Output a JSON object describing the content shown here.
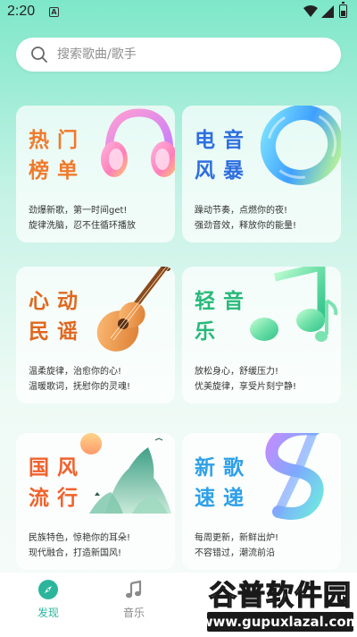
{
  "status_bar": {
    "time": "2:20",
    "notification_icon": "A"
  },
  "search": {
    "placeholder": "搜索歌曲/歌手"
  },
  "cards": [
    {
      "title": "热门榜单",
      "subtitle_line1": "劲爆新歌，第一时间get!",
      "subtitle_line2": "旋律洗脑，忍不住循环播放",
      "title_color": "#f07a2c",
      "icon": "headphones-icon"
    },
    {
      "title": "电音风暴",
      "subtitle_line1": "躁动节奏，点燃你的夜!",
      "subtitle_line2": "强劲音效，释放你的能量!",
      "title_color": "#2f6fe0",
      "icon": "ring-icon"
    },
    {
      "title": "心动民谣",
      "subtitle_line1": "温柔旋律，治愈你的心!",
      "subtitle_line2": "温暖歌词，抚慰你的灵魂!",
      "title_color": "#e0671f",
      "icon": "guitar-icon"
    },
    {
      "title": "轻音乐",
      "subtitle_line1": "放松身心，舒缓压力!",
      "subtitle_line2": "优美旋律，享受片刻宁静!",
      "title_color": "#28b97a",
      "icon": "music-note-icon"
    },
    {
      "title": "国风流行",
      "subtitle_line1": "民族特色，惊艳你的耳朵!",
      "subtitle_line2": "现代融合，打造新国风!",
      "title_color": "#f0622d",
      "icon": "mountain-icon"
    },
    {
      "title": "新歌速递",
      "subtitle_line1": "每周更新，新鲜出炉!",
      "subtitle_line2": "不容错过，潮流前沿",
      "title_color": "#2fa0e8",
      "icon": "infinity-ribbon-icon"
    }
  ],
  "bottom_nav": [
    {
      "label": "发现",
      "icon": "compass-icon",
      "active": true,
      "color": "#2bb69c"
    },
    {
      "label": "音乐",
      "icon": "music-note-icon",
      "active": false,
      "color": "#8a8a8a"
    }
  ],
  "watermark": {
    "line1": "谷普软件园",
    "line2": "www.gupuxlazal.com"
  }
}
